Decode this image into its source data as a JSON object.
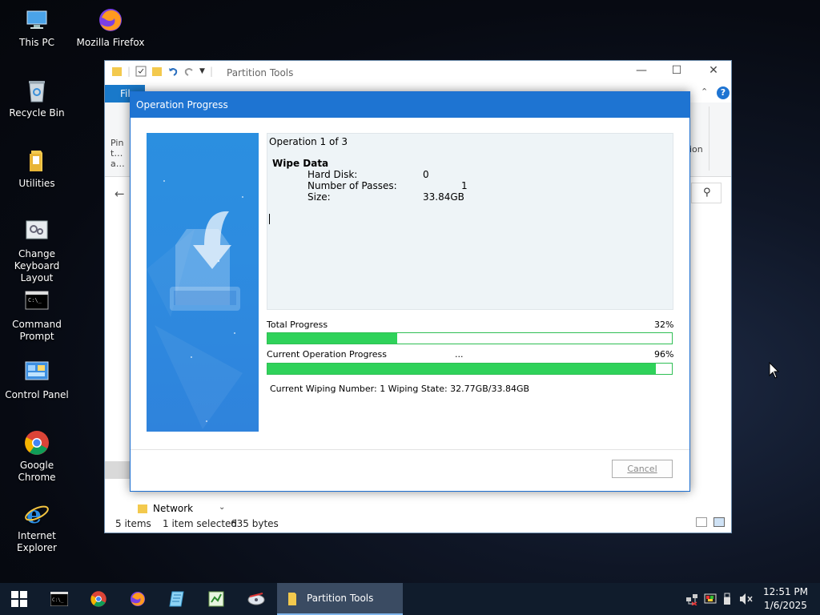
{
  "desktop": {
    "icons": [
      {
        "label": "This PC"
      },
      {
        "label": "Mozilla Firefox"
      },
      {
        "label": "Recycle Bin"
      },
      {
        "label": "Utilities"
      },
      {
        "label": "Change Keyboard Layout"
      },
      {
        "label": "Command Prompt"
      },
      {
        "label": "Control Panel"
      },
      {
        "label": "Google Chrome"
      },
      {
        "label": "Internet Explorer"
      }
    ]
  },
  "explorer": {
    "title": "Partition Tools",
    "file_tab": "File",
    "ribbon_left_text": "Pin t… a…",
    "ribbon_right_text": "ion",
    "nav_network": "Network",
    "status": {
      "items": "5 items",
      "selected": "1 item selected",
      "size": "635 bytes"
    }
  },
  "dialog": {
    "title": "Operation Progress",
    "operation_count": "Operation 1 of 3",
    "operation_name": "Wipe Data",
    "details": [
      {
        "label": "Hard Disk:",
        "value": "0"
      },
      {
        "label": "Number of Passes:",
        "value": "1"
      },
      {
        "label": "Size:",
        "value": "33.84GB"
      }
    ],
    "total_progress": {
      "label": "Total Progress",
      "percent_text": "32%",
      "value": 0.32
    },
    "current_progress": {
      "label": "Current Operation Progress",
      "ellipsis": "...",
      "percent_text": "96%",
      "value": 0.96
    },
    "wipe_status": "Current Wiping Number: 1  Wiping State: 32.77GB/33.84GB",
    "cancel_label": "Cancel"
  },
  "taskbar": {
    "active_window": "Partition Tools",
    "clock_time": "12:51 PM",
    "clock_date": "1/6/2025"
  },
  "colors": {
    "accent": "#1e74d2",
    "progress_green": "#2fd25a",
    "taskbar": "#101c2c"
  }
}
